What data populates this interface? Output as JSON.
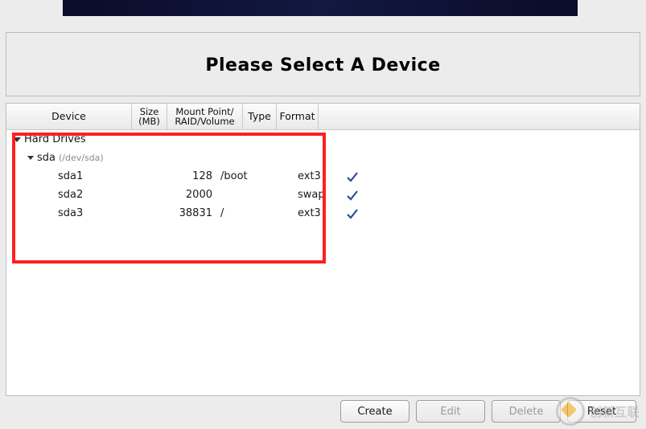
{
  "banner_title": "Please Select A Device",
  "columns": {
    "device": "Device",
    "size": "Size\n(MB)",
    "mount": "Mount Point/\nRAID/Volume",
    "type": "Type",
    "format": "Format"
  },
  "tree": {
    "group_label": "Hard Drives",
    "disk": {
      "name": "sda",
      "path": "(/dev/sda)"
    },
    "partitions": [
      {
        "name": "sda1",
        "size": "128",
        "mount": "/boot",
        "type": "ext3",
        "format": true
      },
      {
        "name": "sda2",
        "size": "2000",
        "mount": "",
        "type": "swap",
        "format": true
      },
      {
        "name": "sda3",
        "size": "38831",
        "mount": "/",
        "type": "ext3",
        "format": true
      }
    ]
  },
  "buttons": {
    "create": "Create",
    "edit": "Edit",
    "delete": "Delete",
    "reset": "Reset"
  },
  "watermark": "创新互联"
}
